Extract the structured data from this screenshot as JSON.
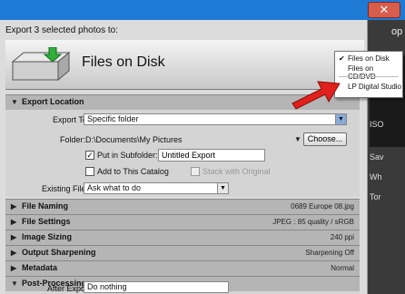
{
  "dialog": {
    "close_label": "✕",
    "export_label": "Export 3 selected photos to:",
    "files_on_disk": "Files on Disk"
  },
  "sections": {
    "export_location": "Export Location",
    "file_naming": {
      "title": "File Naming",
      "summary": "0689 Europe 08.jpg"
    },
    "file_settings": {
      "title": "File Settings",
      "summary": "JPEG : 85 quality / sRGB"
    },
    "image_sizing": {
      "title": "Image Sizing",
      "summary": "240 ppi"
    },
    "output_sharpening": {
      "title": "Output Sharpening",
      "summary": "Sharpening Off"
    },
    "metadata": {
      "title": "Metadata",
      "summary": "Normal"
    },
    "post_processing": "Post-Processing"
  },
  "export_location": {
    "export_to_label": "Export To:",
    "export_to_value": "Specific folder",
    "folder_label": "Folder:",
    "folder_value": "D:\\Documents\\My Pictures",
    "choose_label": "Choose...",
    "put_in_subfolder_label": "Put in Subfolder:",
    "put_in_subfolder_checked": true,
    "subfolder_value": "Untitled Export",
    "add_to_catalog_label": "Add to This Catalog",
    "stack_with_original_label": "Stack with Original",
    "existing_files_label": "Existing Files:",
    "existing_files_value": "Ask what to do"
  },
  "post_processing": {
    "after_export_label": "After Export:",
    "after_export_value": "Do nothing"
  },
  "popup_menu": {
    "items": [
      "Files on Disk",
      "Files on CD/DVD",
      "LP Digital Studio"
    ],
    "checked_item": "Files on Disk"
  },
  "right_panel": {
    "partial_labels": [
      "op",
      "ISO",
      "Sav",
      "Wh",
      "Tor"
    ]
  },
  "colors": {
    "accent_arrow": "#e0201c",
    "titlebar": "#1f7ad6"
  }
}
